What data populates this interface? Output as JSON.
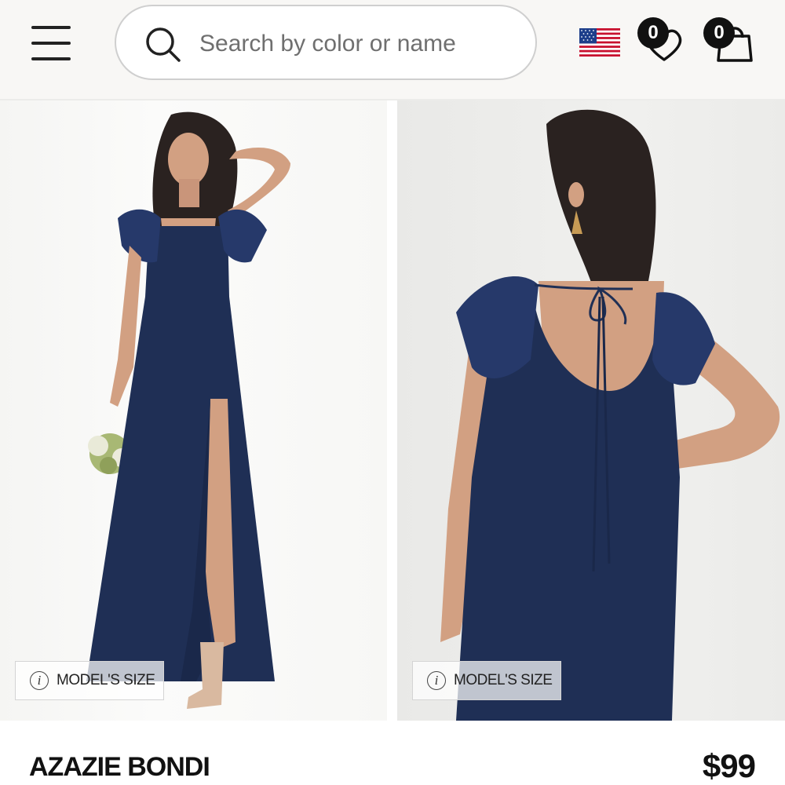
{
  "header": {
    "search": {
      "placeholder": "Search by color or name"
    },
    "wishlist_count": "0",
    "cart_count": "0"
  },
  "gallery": {
    "model_size_label": "MODEL'S SIZE",
    "dress_color": "#1f2f55",
    "skin_color": "#d2a082",
    "hair_color": "#2a2220"
  },
  "product": {
    "name": "AZAZIE BONDI",
    "price": "$99"
  }
}
